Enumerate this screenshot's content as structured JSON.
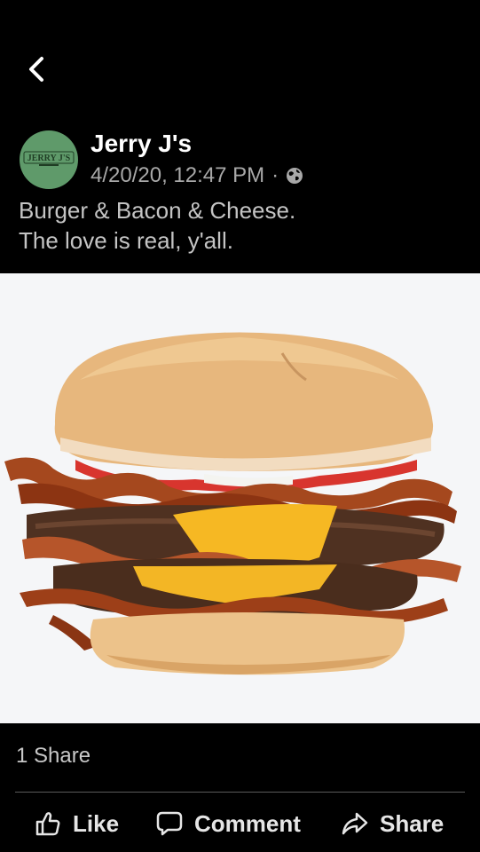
{
  "header": {
    "back_icon": "chevron-left-icon"
  },
  "post": {
    "page_name": "Jerry J's",
    "avatar_text": "JERRY J'S",
    "timestamp": "4/20/20, 12:47 PM",
    "separator": "·",
    "privacy_icon": "globe-icon",
    "caption_line1": "Burger & Bacon & Cheese.",
    "caption_line2": "The love is real, y'all."
  },
  "photo": {
    "subject": "burger-photo"
  },
  "stats": {
    "shares": "1 Share"
  },
  "actions": {
    "like_label": "Like",
    "comment_label": "Comment",
    "share_label": "Share"
  },
  "colors": {
    "background": "#000000",
    "avatar_green": "#5f9a6a",
    "meta_gray": "#a8a8a8",
    "photo_bg": "#f5f6f8"
  }
}
